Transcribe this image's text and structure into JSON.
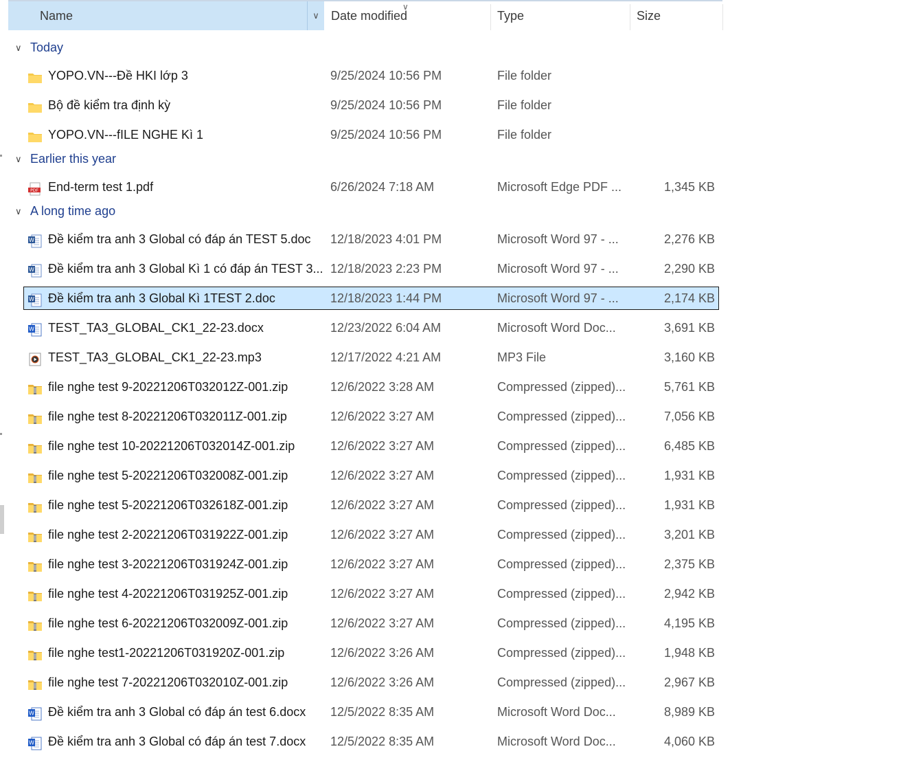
{
  "header": {
    "name": "Name",
    "date": "Date modified",
    "type": "Type",
    "size": "Size"
  },
  "colors": {
    "accent": "#cce4f7",
    "selection": "#cce8ff",
    "group_text": "#1f3f8f"
  },
  "groups": [
    {
      "label": "Today",
      "files": [
        {
          "name": "YOPO.VN---Đề HKI lớp 3",
          "date": "9/25/2024 10:56 PM",
          "type": "File folder",
          "size": "",
          "icon": "folder-icon"
        },
        {
          "name": "Bộ đề kiểm tra định kỳ",
          "date": "9/25/2024 10:56 PM",
          "type": "File folder",
          "size": "",
          "icon": "folder-icon"
        },
        {
          "name": "YOPO.VN---fILE NGHE Kì 1",
          "date": "9/25/2024 10:56 PM",
          "type": "File folder",
          "size": "",
          "icon": "folder-icon"
        }
      ]
    },
    {
      "label": "Earlier this year",
      "files": [
        {
          "name": "End-term test 1.pdf",
          "date": "6/26/2024 7:18 AM",
          "type": "Microsoft Edge PDF ...",
          "size": "1,345 KB",
          "icon": "pdf-icon"
        }
      ]
    },
    {
      "label": "A long time ago",
      "files": [
        {
          "name": "Đề kiểm tra anh 3 Global có đáp án TEST 5.doc",
          "date": "12/18/2023 4:01 PM",
          "type": "Microsoft Word 97 - ...",
          "size": "2,276 KB",
          "icon": "word-doc-icon"
        },
        {
          "name": "Đề kiểm tra anh 3 Global Kì 1 có đáp án TEST 3....",
          "date": "12/18/2023 2:23 PM",
          "type": "Microsoft Word 97 - ...",
          "size": "2,290 KB",
          "icon": "word-doc-icon"
        },
        {
          "name": "Đề kiểm tra anh 3 Global Kì 1TEST 2.doc",
          "date": "12/18/2023 1:44 PM",
          "type": "Microsoft Word 97 - ...",
          "size": "2,174 KB",
          "icon": "word-doc-icon",
          "selected": true
        },
        {
          "name": "TEST_TA3_GLOBAL_CK1_22-23.docx",
          "date": "12/23/2022 6:04 AM",
          "type": "Microsoft Word Doc...",
          "size": "3,691 KB",
          "icon": "word-docx-icon"
        },
        {
          "name": "TEST_TA3_GLOBAL_CK1_22-23.mp3",
          "date": "12/17/2022 4:21 AM",
          "type": "MP3 File",
          "size": "3,160 KB",
          "icon": "mp3-icon"
        },
        {
          "name": "file nghe test 9-20221206T032012Z-001.zip",
          "date": "12/6/2022 3:28 AM",
          "type": "Compressed (zipped)...",
          "size": "5,761 KB",
          "icon": "zip-folder-icon"
        },
        {
          "name": "file nghe test 8-20221206T032011Z-001.zip",
          "date": "12/6/2022 3:27 AM",
          "type": "Compressed (zipped)...",
          "size": "7,056 KB",
          "icon": "zip-folder-icon"
        },
        {
          "name": "file nghe test 10-20221206T032014Z-001.zip",
          "date": "12/6/2022 3:27 AM",
          "type": "Compressed (zipped)...",
          "size": "6,485 KB",
          "icon": "zip-folder-icon"
        },
        {
          "name": "file nghe test 5-20221206T032008Z-001.zip",
          "date": "12/6/2022 3:27 AM",
          "type": "Compressed (zipped)...",
          "size": "1,931 KB",
          "icon": "zip-folder-icon"
        },
        {
          "name": "file nghe test 5-20221206T032618Z-001.zip",
          "date": "12/6/2022 3:27 AM",
          "type": "Compressed (zipped)...",
          "size": "1,931 KB",
          "icon": "zip-folder-icon"
        },
        {
          "name": "file nghe test 2-20221206T031922Z-001.zip",
          "date": "12/6/2022 3:27 AM",
          "type": "Compressed (zipped)...",
          "size": "3,201 KB",
          "icon": "zip-folder-icon"
        },
        {
          "name": "file nghe test 3-20221206T031924Z-001.zip",
          "date": "12/6/2022 3:27 AM",
          "type": "Compressed (zipped)...",
          "size": "2,375 KB",
          "icon": "zip-folder-icon"
        },
        {
          "name": "file nghe test 4-20221206T031925Z-001.zip",
          "date": "12/6/2022 3:27 AM",
          "type": "Compressed (zipped)...",
          "size": "2,942 KB",
          "icon": "zip-folder-icon"
        },
        {
          "name": "file nghe test 6-20221206T032009Z-001.zip",
          "date": "12/6/2022 3:27 AM",
          "type": "Compressed (zipped)...",
          "size": "4,195 KB",
          "icon": "zip-folder-icon"
        },
        {
          "name": "file nghe test1-20221206T031920Z-001.zip",
          "date": "12/6/2022 3:26 AM",
          "type": "Compressed (zipped)...",
          "size": "1,948 KB",
          "icon": "zip-folder-icon"
        },
        {
          "name": "file nghe test 7-20221206T032010Z-001.zip",
          "date": "12/6/2022 3:26 AM",
          "type": "Compressed (zipped)...",
          "size": "2,967 KB",
          "icon": "zip-folder-icon"
        },
        {
          "name": "Đề kiểm tra anh 3 Global có đáp án  test 6.docx",
          "date": "12/5/2022 8:35 AM",
          "type": "Microsoft Word Doc...",
          "size": "8,989 KB",
          "icon": "word-docx-icon"
        },
        {
          "name": "Đề kiểm tra anh 3 Global có đáp án test 7.docx",
          "date": "12/5/2022 8:35 AM",
          "type": "Microsoft Word Doc...",
          "size": "4,060 KB",
          "icon": "word-docx-icon"
        }
      ]
    }
  ]
}
